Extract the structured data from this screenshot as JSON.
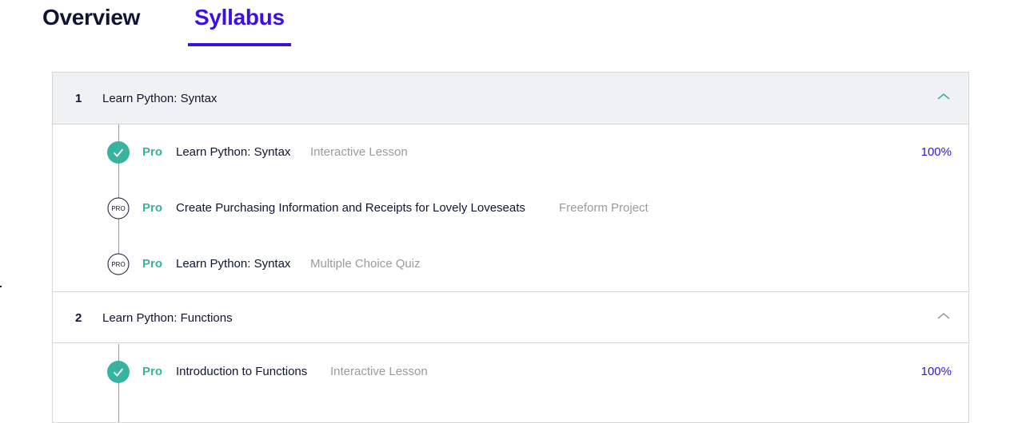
{
  "tabs": [
    {
      "label": "Overview",
      "active": false
    },
    {
      "label": "Syllabus",
      "active": true
    }
  ],
  "colors": {
    "accent": "#3a10e5",
    "pro": "#37b3a0",
    "complete_check": "#37b3a0",
    "muted_text": "#9b9b9b"
  },
  "modules": [
    {
      "number": "1",
      "title": "Learn Python: Syntax",
      "expanded": true,
      "chevron_icon": "chevron-up-icon",
      "items": [
        {
          "status_icon": "check-circle-icon",
          "badge": "Pro",
          "title": "Learn Python: Syntax",
          "type": "Interactive Lesson",
          "progress": "100%"
        },
        {
          "status_icon": "pro-circle-icon",
          "icon_text": "PRO",
          "badge": "Pro",
          "title": "Create Purchasing Information and Receipts for Lovely Loveseats",
          "type": "Freeform Project",
          "progress": ""
        },
        {
          "status_icon": "pro-circle-icon",
          "icon_text": "PRO",
          "badge": "Pro",
          "title": "Learn Python: Syntax",
          "type": "Multiple Choice Quiz",
          "progress": ""
        }
      ]
    },
    {
      "number": "2",
      "title": "Learn Python: Functions",
      "expanded": true,
      "chevron_icon": "chevron-up-icon",
      "items": [
        {
          "status_icon": "check-circle-icon",
          "badge": "Pro",
          "title": "Introduction to Functions",
          "type": "Interactive Lesson",
          "progress": "100%"
        }
      ]
    }
  ]
}
